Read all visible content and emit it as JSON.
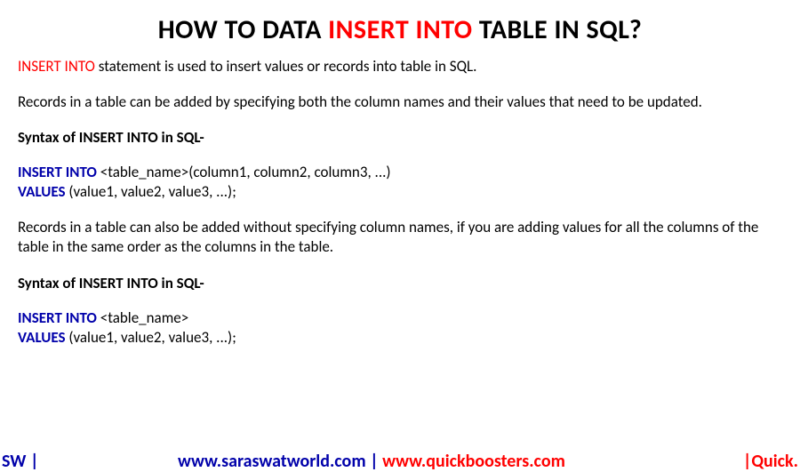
{
  "title": {
    "prefix": "HOW TO DATA ",
    "highlight": "INSERT INTO",
    "suffix": " TABLE IN SQL?"
  },
  "intro": {
    "keyword": "INSERT INTO",
    "rest": " statement is used to insert values or records into table in SQL."
  },
  "para2": "Records in a table can be added by specifying both the column names and their values that need to be updated.",
  "syntax_heading": "Syntax of INSERT INTO in SQL-",
  "code1": {
    "line1_kw": "INSERT INTO",
    "line1_rest": " <table_name>(column1, column2, column3, ...)",
    "line2_kw": "VALUES",
    "line2_rest": " (value1, value2, value3, ...);"
  },
  "para3": "Records in a table can also be added without specifying column names, if you are adding values for all the columns of the table in the same order as the columns in the table.",
  "code2": {
    "line1_kw": "INSERT INTO",
    "line1_rest": " <table_name>",
    "line2_kw": "VALUES",
    "line2_rest": " (value1, value2, value3, ...);"
  },
  "footer": {
    "left": "SW |",
    "center_navy": "www.saraswatworld.com | ",
    "center_red": "www.quickboosters.com",
    "right": "|Quick."
  }
}
